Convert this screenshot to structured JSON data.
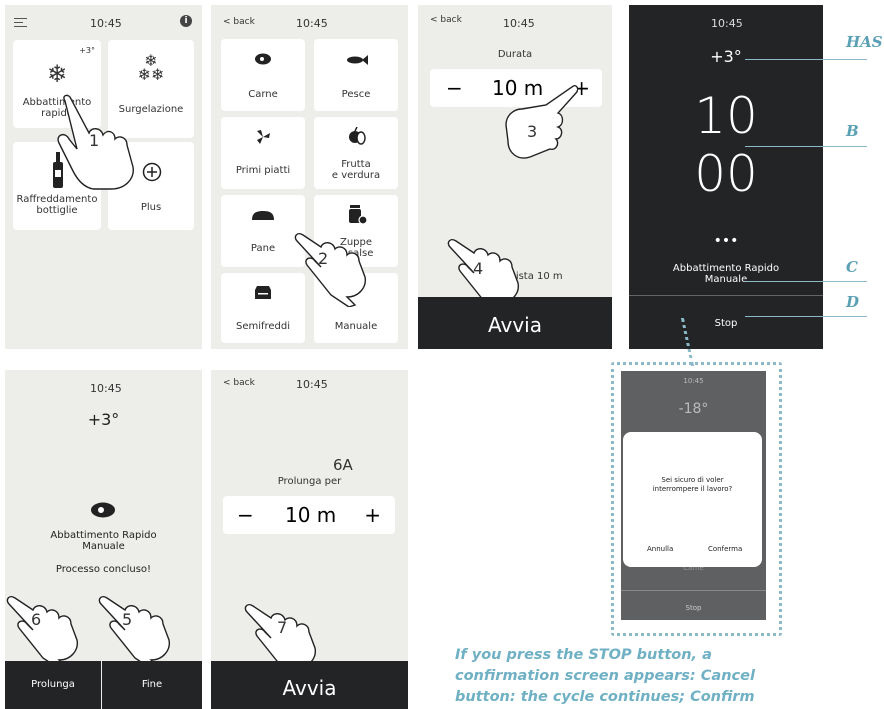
{
  "screen1": {
    "time": "10:45",
    "tiles": [
      {
        "label": "Abbattimento\nrapido",
        "badge": "+3°",
        "icon": "snowflake-icon"
      },
      {
        "label": "Surgelazione",
        "icon": "snowflakes-icon"
      },
      {
        "label": "Raffreddamento\nbottiglie",
        "icon": "bottle-icon"
      },
      {
        "label": "Plus",
        "icon": "plus-circle-icon"
      }
    ],
    "step": "1"
  },
  "screen2": {
    "back": "back",
    "time": "10:45",
    "tiles": [
      {
        "label": "Carne",
        "icon": "meat-icon"
      },
      {
        "label": "Pesce",
        "icon": "fish-icon"
      },
      {
        "label": "Primi piatti",
        "icon": "pasta-icon"
      },
      {
        "label": "Frutta\ne verdura",
        "icon": "fruit-icon"
      },
      {
        "label": "Pane",
        "icon": "bread-icon"
      },
      {
        "label": "Zuppe\ne salse",
        "icon": "jar-icon"
      },
      {
        "label": "Semifreddi",
        "icon": "cake-icon"
      },
      {
        "label": "Manuale",
        "icon": "manual-icon"
      }
    ],
    "step": "2"
  },
  "screen3": {
    "back": "back",
    "time": "10:45",
    "label": "Durata",
    "minus": "−",
    "value": "10 m",
    "plus": "+",
    "preview": "Prevista 10 m",
    "action": "Avvia",
    "step_a": "3",
    "step_b": "4"
  },
  "screen4": {
    "time": "10:45",
    "temp": "+3°",
    "big_top": "10",
    "big_bottom": "00",
    "dots": "•••",
    "mode": "Abbattimento Rapido\nManuale",
    "stop": "Stop"
  },
  "screen5": {
    "time": "10:45",
    "temp": "+3°",
    "mode": "Abbattimento Rapido\nManuale",
    "status": "Processo concluso!",
    "btn_left": "Prolunga",
    "btn_right": "Fine",
    "step_a": "6",
    "step_b": "5"
  },
  "screen6": {
    "back": "back",
    "time": "10:45",
    "tag": "6A",
    "label": "Prolunga per",
    "minus": "−",
    "value": "10 m",
    "plus": "+",
    "action": "Avvia",
    "step": "7"
  },
  "dialog": {
    "time": "10:45",
    "temp": "-18°",
    "question": "Sei sicuro di voler\ninterrompere il lavoro?",
    "cancel": "Annulla",
    "confirm": "Conferma",
    "behind": "Carne",
    "stop": "Stop"
  },
  "callouts": {
    "has": "HAS",
    "b": "B",
    "c": "C",
    "d": "D"
  },
  "caption": "If you press the STOP button, a\nconfirmation screen appears: Cancel\nbutton: the cycle continues; Confirm",
  "colors": {
    "dark": "#222426",
    "panel": "#ededea",
    "accent": "#5aa0b4"
  }
}
